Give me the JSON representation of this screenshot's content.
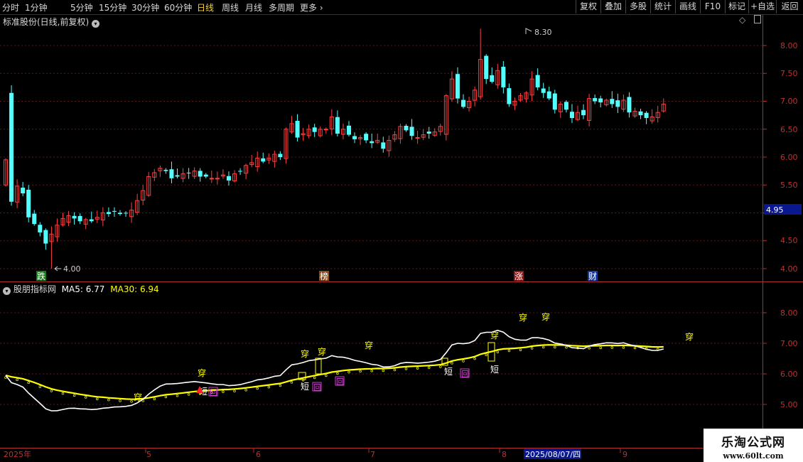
{
  "toolbar": {
    "periods": [
      "分时",
      "1分钟",
      "5分钟",
      "15分钟",
      "30分钟",
      "60分钟",
      "日线",
      "周线",
      "月线",
      "多周期",
      "更多"
    ],
    "active_period": "日线",
    "buttons": [
      "复权",
      "叠加",
      "多股",
      "统计",
      "画线",
      "F10",
      "标记",
      "+自选",
      "返回"
    ]
  },
  "main_panel": {
    "title": "标准股份(日线,前复权)",
    "price_ticks": [
      "8.00",
      "7.50",
      "7.00",
      "6.50",
      "6.00",
      "5.50",
      "4.95",
      "4.50",
      "4.00"
    ],
    "current_price": "4.95",
    "high_label": "8.30",
    "low_label": "4.00",
    "markers": [
      "跌",
      "榜",
      "涨",
      "财"
    ]
  },
  "indicator_panel": {
    "name": "股朋指标网",
    "ma5_label": "MA5: 6.77",
    "ma30_label": "MA30: 6.94",
    "ticks": [
      "8.00",
      "7.00",
      "6.00",
      "5.00"
    ],
    "signals": {
      "chuan": "穿",
      "duan": "短",
      "hui": "回"
    }
  },
  "time_axis": {
    "labels": [
      "2025年",
      "5",
      "6",
      "7",
      "8",
      "9"
    ],
    "cursor_date": "2025/08/07/四"
  },
  "watermark": {
    "line1": "乐淘公式网",
    "line2": "www.60lt.com"
  },
  "colors": {
    "up": "#ff4040",
    "down": "#54ffff",
    "ma5": "#ffffff",
    "ma30": "#ffff00",
    "axis": "#b03030",
    "grid": "#5a1a1a",
    "text": "#d8d8d8"
  },
  "chart_data": {
    "type": "candlestick",
    "title": "标准股份(日线,前复权)",
    "period": "daily",
    "price_high": 8.3,
    "price_low": 4.0,
    "last_close": 4.95,
    "ylim": [
      3.8,
      8.4
    ],
    "series": [
      {
        "name": "MA5",
        "last": 6.77
      },
      {
        "name": "MA30",
        "last": 6.94
      }
    ],
    "closes": [
      5.95,
      5.2,
      5.48,
      5.35,
      4.92,
      4.8,
      4.65,
      4.45,
      4.62,
      4.78,
      4.9,
      4.95,
      4.9,
      4.85,
      4.88,
      4.85,
      4.92,
      5.0,
      4.98,
      5.02,
      4.98,
      5.0,
      5.05,
      5.22,
      5.4,
      5.65,
      5.72,
      5.8,
      5.75,
      5.62,
      5.65,
      5.7,
      5.72,
      5.75,
      5.65,
      5.65,
      5.62,
      5.62,
      5.68,
      5.58,
      5.7,
      5.75,
      5.85,
      5.9,
      5.98,
      5.92,
      5.98,
      6.05,
      6.0,
      6.5,
      6.6,
      6.35,
      6.42,
      6.5,
      6.45,
      6.5,
      6.5,
      6.72,
      6.42,
      6.5,
      6.4,
      6.32,
      6.35,
      6.3,
      6.25,
      6.3,
      6.15,
      6.3,
      6.4,
      6.55,
      6.48,
      6.38,
      6.35,
      6.4,
      6.42,
      6.45,
      6.55,
      7.1,
      7.4,
      7.05,
      6.9,
      7.0,
      7.2,
      7.75,
      7.4,
      7.35,
      7.55,
      7.25,
      6.95,
      7.0,
      7.1,
      7.15,
      7.4,
      7.25,
      7.15,
      7.05,
      6.85,
      6.95,
      6.85,
      6.7,
      6.8,
      6.75,
      7.05,
      7.0,
      6.98,
      7.02,
      6.95,
      6.9,
      7.02,
      6.8,
      6.82,
      6.75,
      6.7,
      6.72,
      6.8,
      6.95
    ]
  }
}
